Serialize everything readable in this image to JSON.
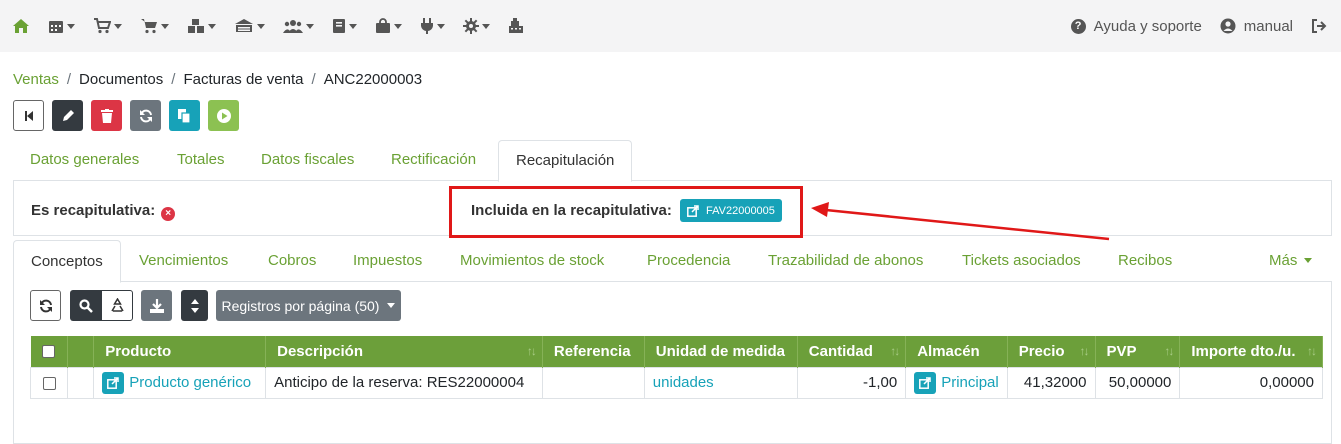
{
  "topbar": {
    "help_label": "Ayuda y soporte",
    "user_label": "manual"
  },
  "breadcrumb": [
    "Ventas",
    "Documentos",
    "Facturas de venta",
    "ANC22000003"
  ],
  "tabs1": [
    "Datos generales",
    "Totales",
    "Datos fiscales",
    "Rectificación",
    "Recapitulación"
  ],
  "recap": {
    "es_label": "Es recapitulativa:",
    "incl_label": "Incluida en la recapitulativa:",
    "badge": "FAV22000005"
  },
  "tabs2": [
    "Conceptos",
    "Vencimientos",
    "Cobros",
    "Impuestos",
    "Movimientos de stock",
    "Procedencia",
    "Trazabilidad de abonos",
    "Tickets asociados",
    "Recibos"
  ],
  "more_label": "Más",
  "toolbar": {
    "per_page": "Registros por página (50)"
  },
  "table": {
    "headers": [
      "Producto",
      "Descripción",
      "Referencia",
      "Unidad de medida",
      "Cantidad",
      "Almacén",
      "Precio",
      "PVP",
      "Importe dto./u."
    ],
    "row": {
      "producto": "Producto genérico",
      "descripcion": "Anticipo de la reserva: RES22000004",
      "referencia": "",
      "unidad": "unidades",
      "cantidad": "-1,00",
      "almacen": "Principal",
      "precio": "41,32000",
      "pvp": "50,00000",
      "importe": "0,00000"
    }
  },
  "colors": {
    "accent": "#6aa134",
    "header": "#6c9f3a",
    "info": "#17a2b8",
    "danger": "#dc3545",
    "highlight": "#e01818"
  }
}
